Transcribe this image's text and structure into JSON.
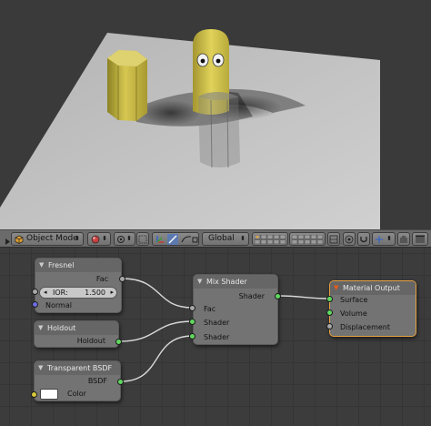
{
  "header": {
    "mode_label": "Object Mode",
    "orientation_label": "Global"
  },
  "nodes": {
    "fresnel": {
      "title": "Fresnel",
      "output_fac": "Fac",
      "ior_label": "IOR:",
      "ior_value": "1.500",
      "input_normal": "Normal"
    },
    "holdout": {
      "title": "Holdout",
      "output_holdout": "Holdout"
    },
    "transparent": {
      "title": "Transparent BSDF",
      "output_bsdf": "BSDF",
      "input_color": "Color",
      "color_value": "#ffffff"
    },
    "mix": {
      "title": "Mix Shader",
      "output_shader": "Shader",
      "input_fac": "Fac",
      "input_shader_1": "Shader",
      "input_shader_2": "Shader"
    },
    "output": {
      "title": "Material Output",
      "input_surface": "Surface",
      "input_volume": "Volume",
      "input_displacement": "Displacement"
    }
  },
  "colors": {
    "shader_socket": "#5fd85f",
    "value_socket": "#a8a8a8",
    "vector_socket": "#6c6ce0",
    "color_socket": "#d8c83c",
    "active_node_border": "#e6a040"
  }
}
